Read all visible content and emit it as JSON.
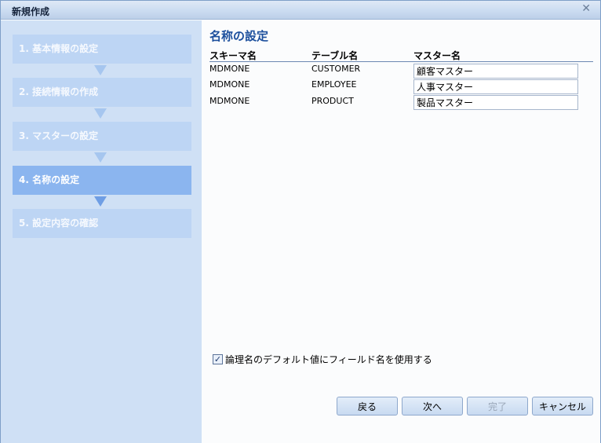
{
  "window": {
    "title": "新規作成",
    "close_glyph": "✕"
  },
  "steps": [
    {
      "label": "1. 基本情報の設定",
      "active": false
    },
    {
      "label": "2. 接続情報の作成",
      "active": false
    },
    {
      "label": "3. マスターの設定",
      "active": false
    },
    {
      "label": "4. 名称の設定",
      "active": true
    },
    {
      "label": "5. 設定内容の確認",
      "active": false
    }
  ],
  "main": {
    "heading": "名称の設定",
    "columns": {
      "schema": "スキーマ名",
      "table": "テーブル名",
      "master": "マスター名"
    },
    "rows": [
      {
        "schema": "MDMONE",
        "table": "CUSTOMER",
        "master": "顧客マスター"
      },
      {
        "schema": "MDMONE",
        "table": "EMPLOYEE",
        "master": "人事マスター"
      },
      {
        "schema": "MDMONE",
        "table": "PRODUCT",
        "master": "製品マスター"
      }
    ],
    "use_field_name_checkbox": {
      "label": "論理名のデフォルト値にフィールド名を使用する",
      "checked": true,
      "check_glyph": "✓"
    }
  },
  "buttons": {
    "back": "戻る",
    "next": "次へ",
    "finish": "完了",
    "cancel": "キャンセル",
    "finish_disabled": true
  },
  "colors": {
    "title_bar": "#cbdcf1",
    "sidebar_bg": "#cfe0f5",
    "step_inactive": "#bdd5f4",
    "step_active": "#8bb5ef",
    "heading": "#1c4f9d"
  }
}
